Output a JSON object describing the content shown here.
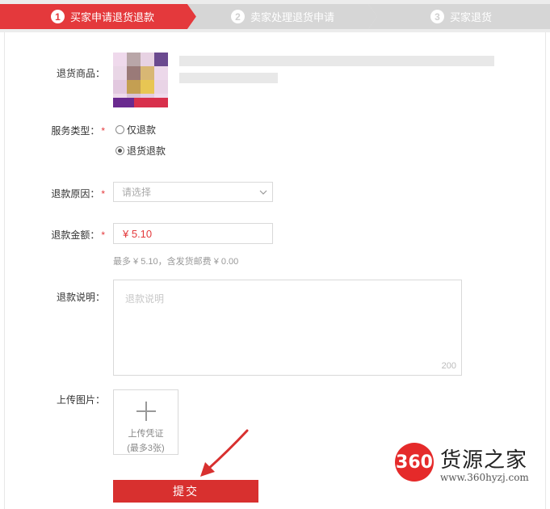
{
  "steps": [
    {
      "num": "1",
      "label": "买家申请退货退款"
    },
    {
      "num": "2",
      "label": "卖家处理退货申请"
    },
    {
      "num": "3",
      "label": "买家退货"
    }
  ],
  "form": {
    "product_label": "退货商品：",
    "service_label": "服务类型：",
    "service_options": [
      "仅退款",
      "退货退款"
    ],
    "reason_label": "退款原因：",
    "reason_placeholder": "请选择",
    "amount_label": "退款金额：",
    "amount_value": "¥ 5.10",
    "amount_hint": "最多 ¥ 5.10，含发货邮费 ¥ 0.00",
    "desc_label": "退款说明：",
    "desc_placeholder": "退款说明",
    "desc_count": "200",
    "upload_label": "上传图片：",
    "upload_text_1": "上传凭证",
    "upload_text_2": "(最多3张)",
    "required_mark": "*",
    "submit_label": "提交"
  },
  "watermark": {
    "logo": "360",
    "title": "货源之家",
    "url": "www.360hyzj.com"
  },
  "colors": {
    "accent": "#e4393c",
    "step_inactive": "#d6d6d6",
    "submit": "#d8302f"
  }
}
